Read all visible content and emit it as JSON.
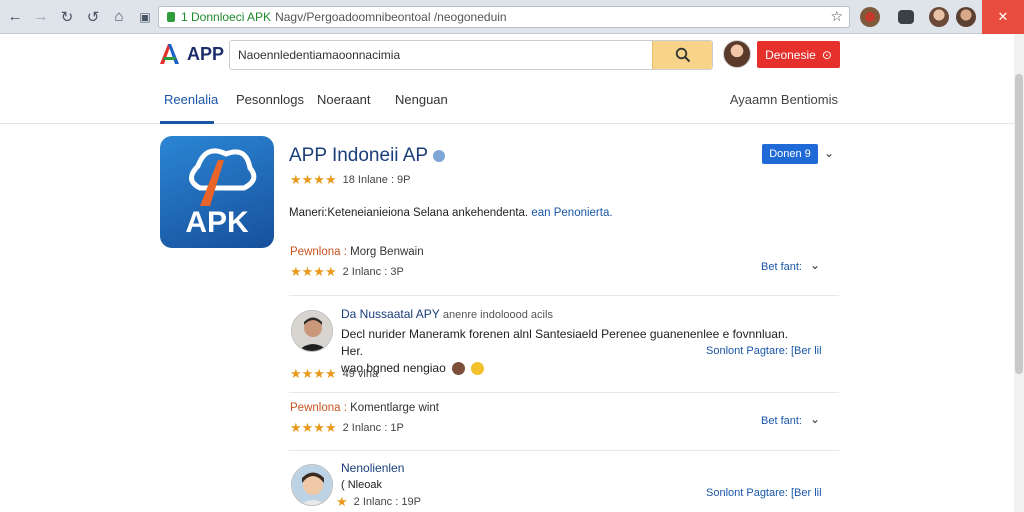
{
  "browser": {
    "url_highlight": "1 Donnloeci APK",
    "url_rest": "Nagv/Pergoadoomnibeontoal /neogoneduin",
    "close_label": "✕"
  },
  "header": {
    "logo_text": "APP",
    "search_value": "Naoennledentiamaoonnacimia",
    "signin_label": "Deonesie",
    "signin_icon": "⊙"
  },
  "tabs": [
    {
      "label": "Reenlalia"
    },
    {
      "label": "Pesonnlogs"
    },
    {
      "label": "Noeraant"
    },
    {
      "label": "Nenguan"
    }
  ],
  "tabs_right": "Ayaamn Bentiomis",
  "app": {
    "icon_text": "APK",
    "title": "APP Indoneii AP",
    "stars": "★★★★",
    "rating_text": "18 Inlane : 9P",
    "description": "Maneri:Keteneianieiona Selana ankehendenta.",
    "description_link": "ean Penonierta.",
    "download_label": "Donen 9"
  },
  "entries": [
    {
      "label_key": "Pewnlona :",
      "label_value": "Morg Benwain",
      "stars": "★★★★",
      "rating_text": "2 Inlanc : 3P",
      "action": "Bet fant:"
    },
    {
      "label_key": "Pewnlona :",
      "label_value": "Komentlarge wint",
      "stars": "★★★★",
      "rating_text": "2 Inlanc : 1P",
      "action": "Bet fant:"
    }
  ],
  "reviews": [
    {
      "name": "Da Nussaatal APY",
      "sub": "anenre indoloood acils",
      "line1": "Decl nurider Maneramk forenen alnl Santesiaeld Perenee guanenenlee e fovnnluan. Her.",
      "line2": "wao bgned nengiao",
      "stars": "★★★★",
      "rating_text": "49 vlha",
      "action": "Sonlont Pagtare: [Ber lil"
    },
    {
      "name": "Nenolienlen",
      "sub": "( Nleoak",
      "stars": "★",
      "rating_text": "2 Inlanc : 19P",
      "action": "Sonlont Pagtare: [Ber lil"
    }
  ],
  "colors": {
    "accent": "#1a56a8",
    "brand_red": "#e5302b",
    "star": "#e99a1d",
    "search_button": "#f7d48a"
  }
}
